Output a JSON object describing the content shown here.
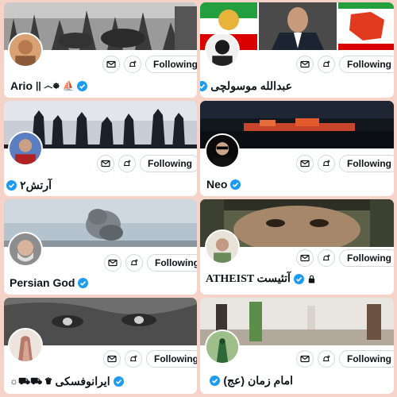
{
  "colors": {
    "page_background": "#f6d3c8",
    "verified": "#1d9bf0",
    "text": "#0f1419",
    "button_border": "#cfd9de"
  },
  "icons": {
    "message": "envelope-icon",
    "notify": "bell-plus-icon",
    "verified": "verified-badge-icon",
    "protected": "lock-icon"
  },
  "cards": [
    {
      "name": "Ario",
      "suffix": "|| ෴☸ ⛵",
      "verified": true,
      "protected": false,
      "follow_label": "Following"
    },
    {
      "name": "عبدالله موسولچی",
      "suffix": "",
      "verified": true,
      "protected": false,
      "follow_label": "Following"
    },
    {
      "name": "آرتش۲",
      "suffix": "",
      "verified": true,
      "protected": false,
      "follow_label": "Following"
    },
    {
      "name": "Neo",
      "suffix": "",
      "verified": true,
      "protected": false,
      "follow_label": "Following"
    },
    {
      "name": "Persian God",
      "suffix": "",
      "verified": true,
      "protected": false,
      "follow_label": "Following"
    },
    {
      "name": "ATHEIST آتئیست",
      "suffix": "",
      "verified": true,
      "protected": true,
      "follow_label": "Following"
    },
    {
      "name": "ایرانوفسکی",
      "suffix": "☼⛟⛟ ♛",
      "verified": true,
      "protected": false,
      "follow_label": "Following"
    },
    {
      "name": "امام زمان (عج)",
      "suffix": "",
      "verified": true,
      "protected": false,
      "follow_label": "Following"
    }
  ]
}
